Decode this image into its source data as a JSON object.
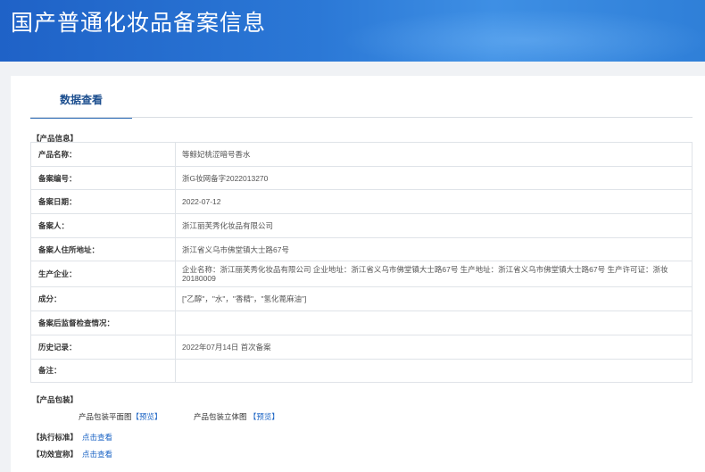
{
  "header": {
    "title": "国产普通化妆品备案信息"
  },
  "tabs": [
    {
      "label": "数据查看"
    }
  ],
  "product_info": {
    "section_label": "【产品信息】",
    "rows": [
      {
        "label": "产品名称：",
        "value": "等鲸妃桃涩暗号香水"
      },
      {
        "label": "备案编号：",
        "value": "浙G妆网备字2022013270"
      },
      {
        "label": "备案日期：",
        "value": "2022-07-12"
      },
      {
        "label": "备案人：",
        "value": "浙江丽芙秀化妆品有限公司"
      },
      {
        "label": "备案人住所地址：",
        "value": "浙江省义乌市佛堂镇大士路67号"
      },
      {
        "label": "生产企业：",
        "value": "企业名称：浙江丽芙秀化妆品有限公司 企业地址：浙江省义乌市佛堂镇大士路67号 生产地址：浙江省义乌市佛堂镇大士路67号 生产许可证：浙妆 20180009"
      },
      {
        "label": "成分：",
        "value": "[\"乙醇\"，\"水\"，\"香精\"，\"氢化蓖麻油\"]"
      },
      {
        "label": "备案后监督检查情况：",
        "value": ""
      },
      {
        "label": "历史记录：",
        "value": "2022年07月14日 首次备案"
      },
      {
        "label": "备注：",
        "value": ""
      }
    ]
  },
  "packaging": {
    "section_label": "【产品包装】",
    "flat_label": "产品包装平面图",
    "flat_link": "【预览】",
    "solid_label": "产品包装立体图",
    "solid_link": "【预览】"
  },
  "standard": {
    "section_label": "【执行标准】",
    "link": "点击查看"
  },
  "efficacy": {
    "section_label": "【功效宣称】",
    "link": "点击查看"
  },
  "colors": {
    "banner": "#2b78d6",
    "link": "#1a63c4",
    "tab_text": "#1d4f8f"
  }
}
